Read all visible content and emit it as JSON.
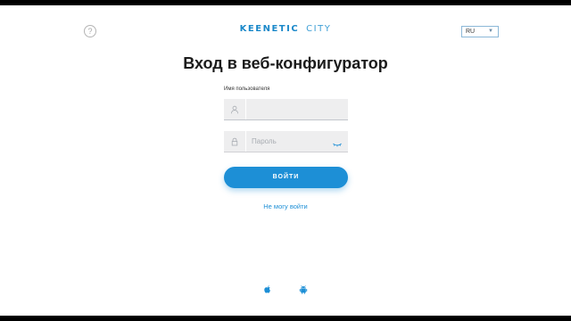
{
  "header": {
    "help_icon": "question-circle-icon",
    "help_glyph": "?",
    "logo_brand": "KEENETIC",
    "logo_model": "CITY",
    "language": "RU"
  },
  "login": {
    "title": "Вход в веб-конфигуратор",
    "username_label": "Имя пользователя",
    "username_value": "",
    "password_placeholder": "Пароль",
    "submit_label": "ВОЙТИ",
    "forgot_link": "Не могу войти"
  },
  "footer": {
    "icons": [
      "apple-icon",
      "android-icon"
    ]
  },
  "colors": {
    "accent": "#1d8fd6",
    "field_bg": "#eeeeef",
    "title": "#1b1b1b"
  }
}
